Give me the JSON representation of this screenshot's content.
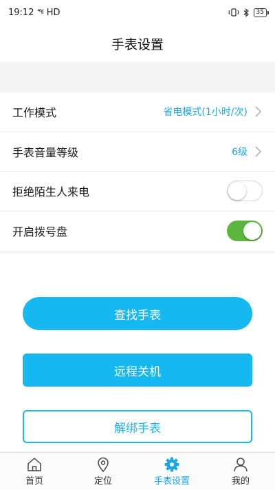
{
  "status_bar": {
    "time": "19:12",
    "signal": "⁴⁶ıl",
    "network": "HD",
    "battery": "35"
  },
  "header": {
    "title": "手表设置"
  },
  "settings": [
    {
      "label": "工作模式",
      "value": "省电模式(1小时/次)",
      "type": "link"
    },
    {
      "label": "手表音量等级",
      "value": "6级",
      "type": "link"
    },
    {
      "label": "拒绝陌生人来电",
      "type": "toggle",
      "on": false
    },
    {
      "label": "开启拨号盘",
      "type": "toggle",
      "on": true
    }
  ],
  "actions": {
    "find": "查找手表",
    "shutdown": "远程关机",
    "unbind": "解绑手表"
  },
  "tabs": [
    {
      "label": "首页",
      "icon": "home-icon",
      "active": false
    },
    {
      "label": "定位",
      "icon": "location-pin-icon",
      "active": false
    },
    {
      "label": "手表设置",
      "icon": "gear-icon",
      "active": true
    },
    {
      "label": "我的",
      "icon": "person-icon",
      "active": false
    }
  ],
  "colors": {
    "accent": "#16b8f1",
    "toggle_on": "#5cb73f",
    "value_text": "#1aa7e8"
  }
}
